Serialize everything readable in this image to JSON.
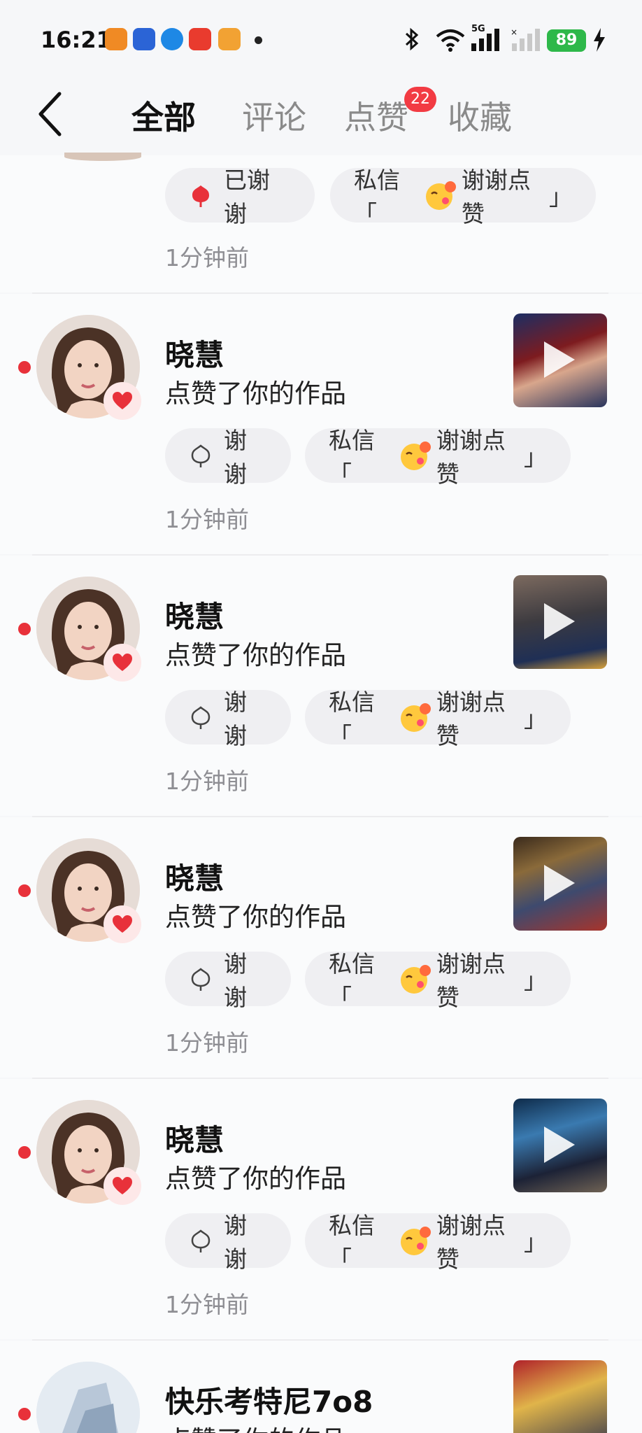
{
  "status_bar": {
    "time": "16:21",
    "network": "5G",
    "battery": "89",
    "app_icon_colors": [
      "#f08a24",
      "#2b64d6",
      "#1e88e5",
      "#e93b2e",
      "#f2a233"
    ]
  },
  "header": {
    "back_icon": "chevron-left-icon",
    "tabs": [
      {
        "label": "全部",
        "active": true
      },
      {
        "label": "评论",
        "active": false
      },
      {
        "label": "点赞",
        "active": false,
        "badge": "22"
      },
      {
        "label": "收藏",
        "active": false
      }
    ]
  },
  "partial_item": {
    "thanked_label": "已谢谢",
    "message_prefix": "私信「",
    "message_text": "谢谢点赞",
    "message_suffix": "」",
    "time": "1分钟前"
  },
  "items": [
    {
      "name": "晓慧",
      "action": "点赞了你的作品",
      "thank_label": "谢谢",
      "message_prefix": "私信「",
      "message_text": "谢谢点赞",
      "message_suffix": "」",
      "time": "1分钟前"
    },
    {
      "name": "晓慧",
      "action": "点赞了你的作品",
      "thank_label": "谢谢",
      "message_prefix": "私信「",
      "message_text": "谢谢点赞",
      "message_suffix": "」",
      "time": "1分钟前"
    },
    {
      "name": "晓慧",
      "action": "点赞了你的作品",
      "thank_label": "谢谢",
      "message_prefix": "私信「",
      "message_text": "谢谢点赞",
      "message_suffix": "」",
      "time": "1分钟前"
    },
    {
      "name": "晓慧",
      "action": "点赞了你的作品",
      "thank_label": "谢谢",
      "message_prefix": "私信「",
      "message_text": "谢谢点赞",
      "message_suffix": "」",
      "time": "1分钟前"
    }
  ],
  "last_item": {
    "name": "快乐考特尼7o8",
    "action": "点赞了你的作品"
  },
  "colors": {
    "accent_red": "#e8313a",
    "badge_red": "#f23b43",
    "background": "#f6f7f9",
    "pill_bg": "#efeff2"
  }
}
